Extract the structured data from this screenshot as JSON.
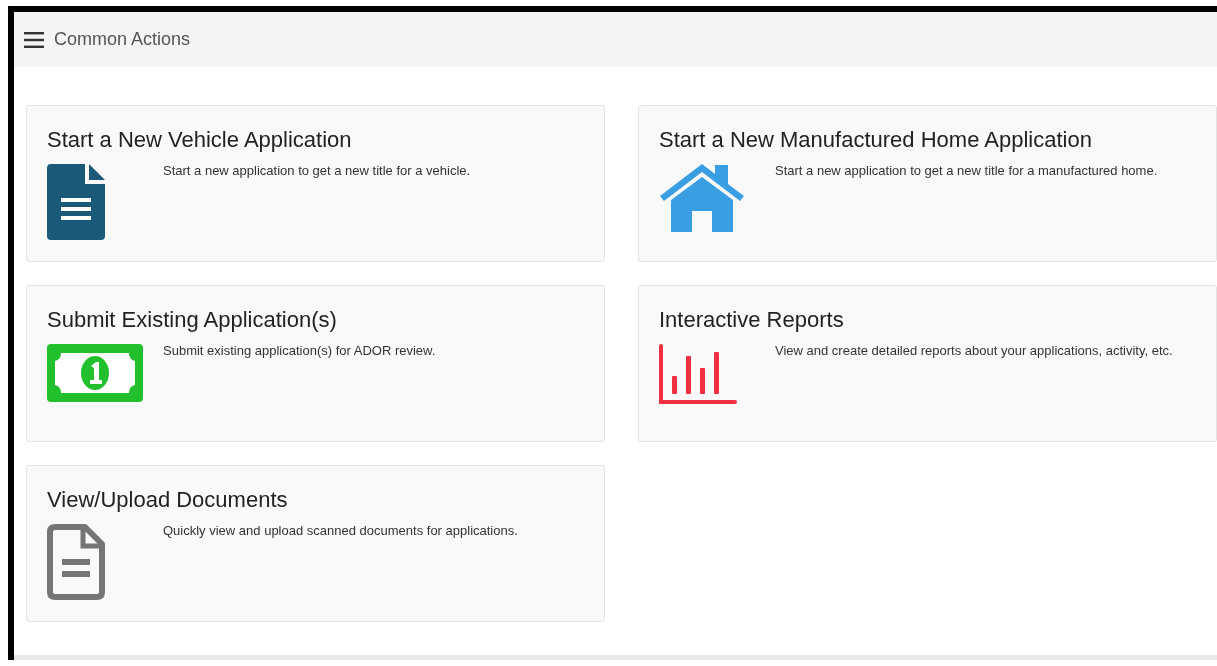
{
  "header": {
    "title": "Common Actions"
  },
  "cards": [
    {
      "kind": "vehicle",
      "title": "Start a New Vehicle Application",
      "description": "Start a new application to get a new title for a vehicle."
    },
    {
      "kind": "home",
      "title": "Start a New Manufactured Home Application",
      "description": "Start a new application to get a new title for a manufactured home."
    },
    {
      "kind": "money",
      "title": "Submit Existing Application(s)",
      "description": "Submit existing application(s) for ADOR review."
    },
    {
      "kind": "reports",
      "title": "Interactive Reports",
      "description": "View and create detailed reports about your applications, activity, etc."
    },
    {
      "kind": "documents",
      "title": "View/Upload Documents",
      "description": "Quickly view and upload scanned documents for applications."
    }
  ]
}
